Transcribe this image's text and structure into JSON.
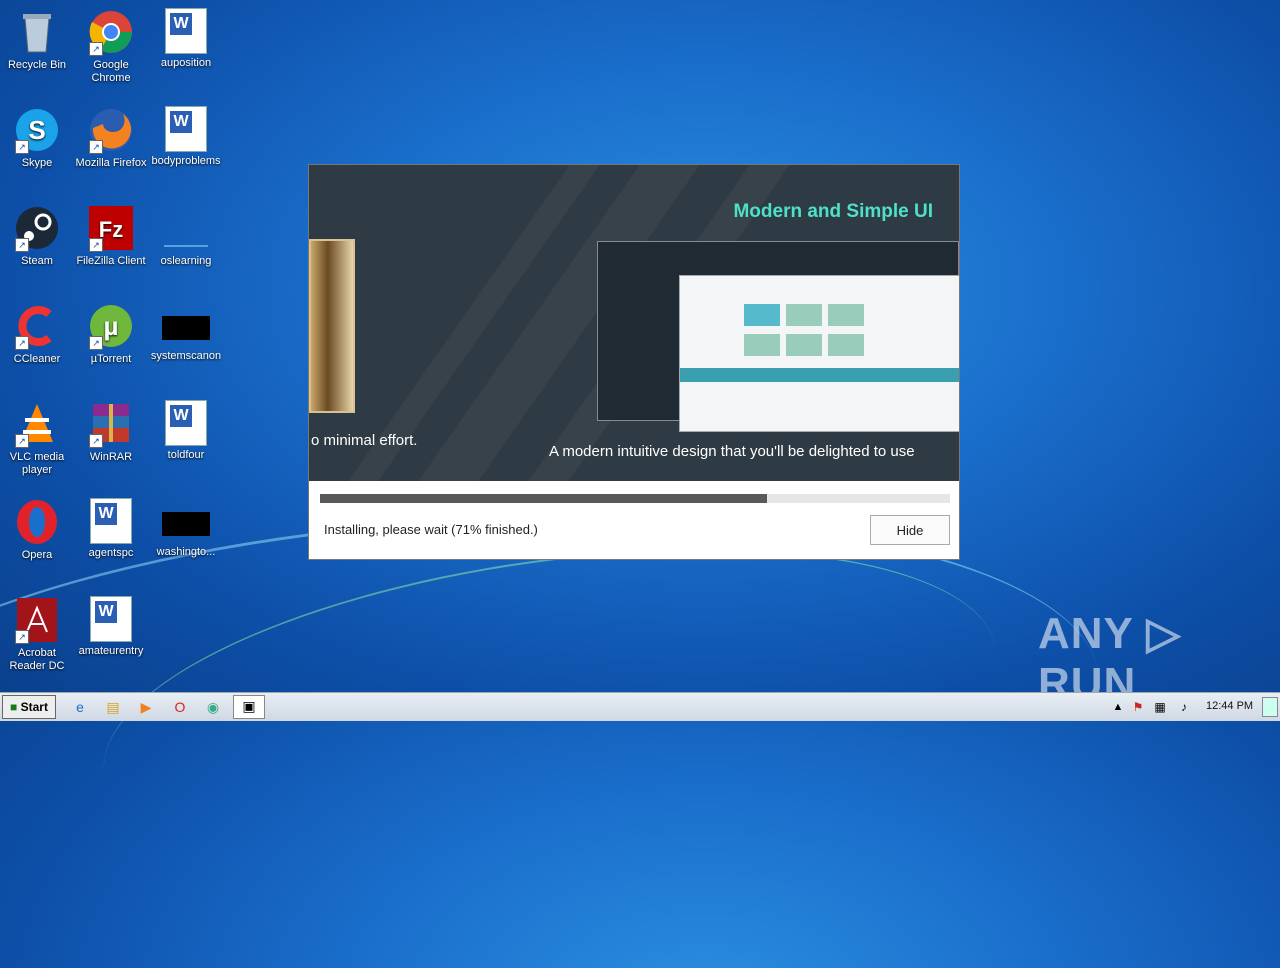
{
  "desktop": {
    "icons": [
      {
        "label": "Recycle Bin",
        "icon": "recycle-bin-icon"
      },
      {
        "label": "Google Chrome",
        "icon": "chrome-icon"
      },
      {
        "label": "auposition",
        "icon": "word-doc-icon"
      },
      {
        "label": "Skype",
        "icon": "skype-icon"
      },
      {
        "label": "Mozilla Firefox",
        "icon": "firefox-icon"
      },
      {
        "label": "bodyproblems",
        "icon": "word-doc-icon"
      },
      {
        "label": "Steam",
        "icon": "steam-icon"
      },
      {
        "label": "FileZilla Client",
        "icon": "filezilla-icon"
      },
      {
        "label": "oslearning",
        "icon": "file-icon"
      },
      {
        "label": "CCleaner",
        "icon": "ccleaner-icon"
      },
      {
        "label": "µTorrent",
        "icon": "utorrent-icon"
      },
      {
        "label": "systemscanon",
        "icon": "black-file-icon"
      },
      {
        "label": "VLC media player",
        "icon": "vlc-icon"
      },
      {
        "label": "WinRAR",
        "icon": "winrar-icon"
      },
      {
        "label": "toldfour",
        "icon": "word-doc-icon"
      },
      {
        "label": "Opera",
        "icon": "opera-icon"
      },
      {
        "label": "agentspc",
        "icon": "word-doc-icon"
      },
      {
        "label": "washingto...",
        "icon": "black-file-icon"
      },
      {
        "label": "Acrobat Reader DC",
        "icon": "acrobat-icon"
      },
      {
        "label": "amateurentry",
        "icon": "word-doc-icon"
      }
    ]
  },
  "installer": {
    "banner_title": "Modern and Simple UI",
    "banner_subtitle": "A modern intuitive design that you'll be delighted to use",
    "banner_left_text": "o minimal effort.",
    "progress_percent": 71,
    "status": "Installing, please wait (71% finished.)",
    "hide_label": "Hide"
  },
  "watermark": "ANY ▷ RUN",
  "taskbar": {
    "start_label": "Start",
    "clock": "12:44 PM"
  }
}
